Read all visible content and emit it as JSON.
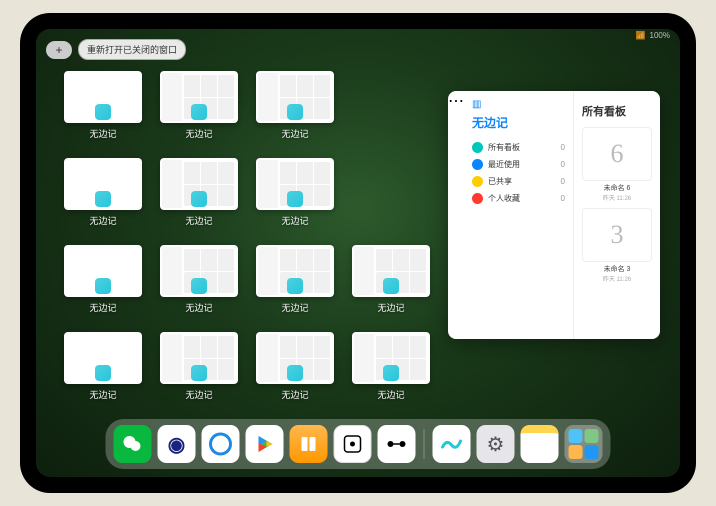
{
  "status": {
    "signal": "📶",
    "battery": "100%"
  },
  "top": {
    "plus": "+",
    "reopen_label": "重新打开已关闭的窗口"
  },
  "app_name": "无边记",
  "sidebar": {
    "title": "无边记",
    "items": [
      {
        "icon_color": "#00c7be",
        "label": "所有看板",
        "count": "0"
      },
      {
        "icon_color": "#0a84ff",
        "label": "最近使用",
        "count": "0"
      },
      {
        "icon_color": "#ffcc00",
        "label": "已共享",
        "count": "0"
      },
      {
        "icon_color": "#ff3b30",
        "label": "个人收藏",
        "count": "0"
      }
    ]
  },
  "boards_panel": {
    "title": "所有看板",
    "boards": [
      {
        "glyph": "6",
        "name": "未命名 6",
        "date": "昨天 11:26"
      },
      {
        "glyph": "3",
        "name": "未命名 3",
        "date": "昨天 11:26"
      }
    ]
  },
  "dock": {
    "apps": [
      {
        "name": "wechat",
        "bg": "#09b83e",
        "glyph": "💬"
      },
      {
        "name": "quark",
        "bg": "#ffffff",
        "glyph": "◉"
      },
      {
        "name": "qqbrowser",
        "bg": "#ffffff",
        "glyph": "◯"
      },
      {
        "name": "play",
        "bg": "#ffffff",
        "glyph": "▶"
      },
      {
        "name": "books",
        "bg": "#ff9500",
        "glyph": "▮▮"
      },
      {
        "name": "dice",
        "bg": "#ffffff",
        "glyph": "⊡"
      },
      {
        "name": "connect",
        "bg": "#ffffff",
        "glyph": "⋈"
      }
    ],
    "recents": [
      {
        "name": "freeform",
        "bg": "#ffffff",
        "glyph": "〰"
      },
      {
        "name": "settings",
        "bg": "#e5e5ea",
        "glyph": "⚙"
      },
      {
        "name": "notes",
        "bg": "#ffffff",
        "glyph": "▤"
      }
    ]
  }
}
